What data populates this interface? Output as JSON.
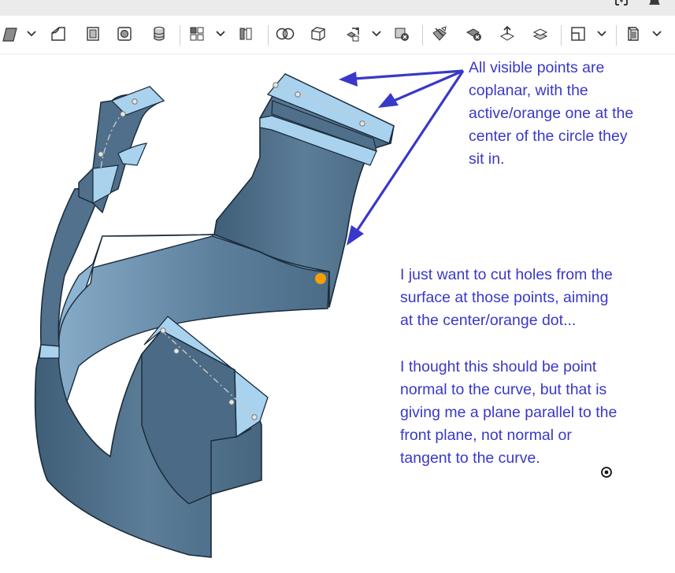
{
  "window": {
    "top_icons": [
      "expand-icon",
      "bell-icon"
    ]
  },
  "toolbar": {
    "buttons": [
      "extrude-icon",
      "dropdown-chevron-icon",
      "fillet-icon",
      "shell-icon",
      "hole-icon",
      "cylinder-icon",
      "pattern-icon",
      "dropdown-chevron-icon",
      "sheet-metal-icon",
      "boolean-icon",
      "plane-icon",
      "transform-icon",
      "dropdown-chevron-icon",
      "delete-part-icon",
      "split-icon",
      "delete-face-icon",
      "move-face-icon",
      "offset-surface-icon",
      "section-view-icon",
      "dropdown-chevron-icon",
      "display-mode-icon",
      "dropdown-chevron-icon"
    ]
  },
  "viewport": {
    "colors": {
      "part_face": "#4f6f8b",
      "part_top": "#a9d2ee",
      "highlight_point": "#f5a000",
      "annotation": "#3a38c8"
    },
    "annotations": [
      "All visible points are\ncoplanar, with the\nactive/orange one at the\ncenter of the circle they\nsit in.",
      "I just want to cut holes from the\nsurface at those points, aiming\nat the center/orange dot...",
      "I thought this should be point\nnormal to the curve, but that is\ngiving me a plane parallel to the\nfront plane, not normal or\ntangent to the curve."
    ]
  }
}
